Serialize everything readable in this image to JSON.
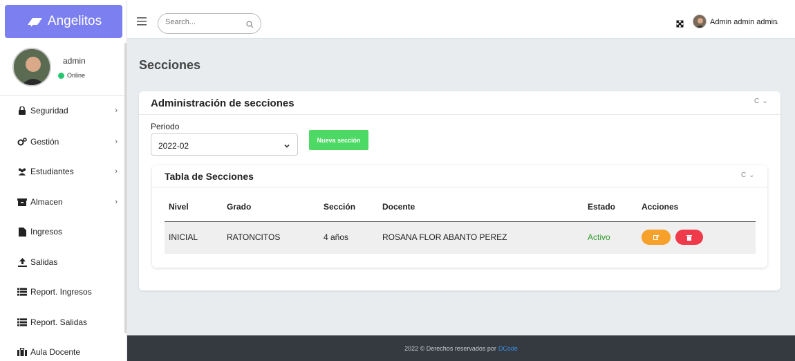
{
  "brand": {
    "name": "Angelitos",
    "color": "#7b7ff0"
  },
  "user": {
    "name": "admin",
    "status": "Online"
  },
  "sidebar": {
    "items": [
      {
        "label": "Seguridad",
        "icon": "lock-icon",
        "has_submenu": true
      },
      {
        "label": "Gestión",
        "icon": "gears-icon",
        "has_submenu": true
      },
      {
        "label": "Estudiantes",
        "icon": "users-icon",
        "has_submenu": true
      },
      {
        "label": "Almacen",
        "icon": "archive-icon",
        "has_submenu": true
      },
      {
        "label": "Ingresos",
        "icon": "file-icon",
        "has_submenu": false
      },
      {
        "label": "Salidas",
        "icon": "upload-icon",
        "has_submenu": false
      },
      {
        "label": "Report. Ingresos",
        "icon": "list-icon",
        "has_submenu": false
      },
      {
        "label": "Report. Salidas",
        "icon": "list-icon",
        "has_submenu": false
      },
      {
        "label": "Aula Docente",
        "icon": "briefcase-icon",
        "has_submenu": false
      }
    ]
  },
  "topbar": {
    "search_placeholder": "Search...",
    "user_label": "Admin admin admin"
  },
  "page": {
    "title": "Secciones"
  },
  "card": {
    "title": "Administración de secciones",
    "periodo_label": "Periodo",
    "periodo_value": "2022-02",
    "new_button": "Nueva sección"
  },
  "table": {
    "title": "Tabla de Secciones",
    "headers": [
      "Nivel",
      "Grado",
      "Sección",
      "Docente",
      "Estado",
      "Acciones"
    ],
    "rows": [
      {
        "nivel": "INICIAL",
        "grado": "RATONCITOS",
        "seccion": "4 años",
        "docente": "ROSANA FLOR ABANTO PEREZ",
        "estado": "Activo"
      }
    ]
  },
  "footer": {
    "text": "2022 © Derechos reservados por",
    "link": "DCode"
  },
  "colors": {
    "success": "#4cd964",
    "warning": "#f7a02a",
    "danger": "#ee3a4a",
    "online": "#28c76f",
    "footer_bg": "#343a40"
  }
}
